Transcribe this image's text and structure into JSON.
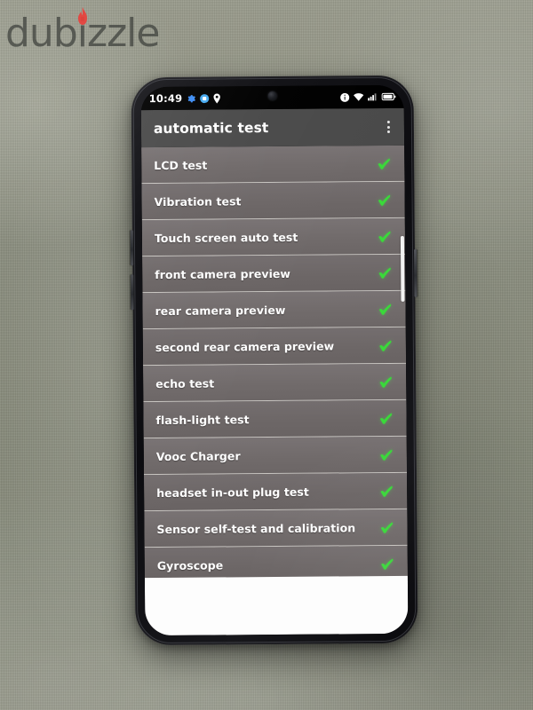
{
  "watermark": {
    "brand": "dubizzle",
    "flame_color": "#e8413c"
  },
  "status_bar": {
    "clock": "10:49",
    "left_icons": [
      "gear-icon",
      "app-badge-icon",
      "location-pin-icon"
    ],
    "right_icons": [
      "info-icon",
      "wifi-icon",
      "cellular-signal-icon",
      "battery-icon"
    ],
    "battery_level_percent": 85
  },
  "app_bar": {
    "title": "automatic test",
    "overflow_label": "more-options",
    "background_color": "#4a4a4a",
    "title_color": "#ffffff"
  },
  "theme": {
    "row_background": "#6e6a6a",
    "check_color": "#3ad93a",
    "divider_color": "#c9c6c2",
    "screen_background": "#000000",
    "backdrop_color": "#8a8d80"
  },
  "test_list": {
    "status_icon": "check-mark-icon",
    "items": [
      {
        "label": "LCD test",
        "status": "passed"
      },
      {
        "label": "Vibration test",
        "status": "passed"
      },
      {
        "label": "Touch screen auto test",
        "status": "passed"
      },
      {
        "label": "front camera preview",
        "status": "passed"
      },
      {
        "label": "rear camera preview",
        "status": "passed"
      },
      {
        "label": "second rear camera preview",
        "status": "passed"
      },
      {
        "label": "echo test",
        "status": "passed"
      },
      {
        "label": "flash-light test",
        "status": "passed"
      },
      {
        "label": "Vooc Charger",
        "status": "passed"
      },
      {
        "label": "headset in-out plug test",
        "status": "passed"
      },
      {
        "label": "Sensor self-test and calibration",
        "status": "passed"
      },
      {
        "label": "Gyroscope",
        "status": "passed"
      }
    ]
  },
  "scrollbar": {
    "name": "vertical-scrollbar"
  },
  "device": {
    "side_buttons": [
      "volume-up-button",
      "volume-down-button",
      "power-button"
    ]
  }
}
